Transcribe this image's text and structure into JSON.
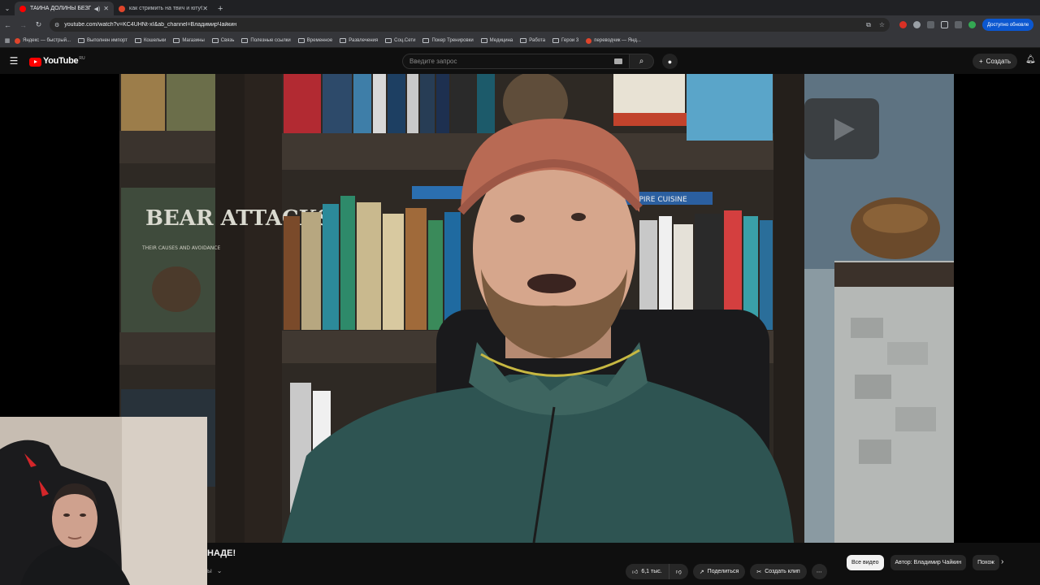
{
  "browser": {
    "tabs": [
      {
        "title": "ТАЙНА ДОЛИНЫ БЕЗГОЛ",
        "favicon_color": "#ff0000",
        "active": true,
        "audio": true
      },
      {
        "title": "как стримить на твич и ютуб",
        "favicon_color": "#e0452b",
        "active": false,
        "audio": false
      }
    ],
    "new_tab_label": "+",
    "url": "youtube.com/watch?v=KC4UHNt-xI&ab_channel=ВладимирЧайкин",
    "update_label": "Доступно обновле",
    "bookmarks": [
      {
        "label": "Яндекс — быстрый..."
      },
      {
        "label": "Выполнен импорт"
      },
      {
        "label": "Кошельки"
      },
      {
        "label": "Магазины"
      },
      {
        "label": "Связь"
      },
      {
        "label": "Полезные ссылки"
      },
      {
        "label": "Временное"
      },
      {
        "label": "Развлечения"
      },
      {
        "label": "Соц.Сети"
      },
      {
        "label": "Покер Тренировки"
      },
      {
        "label": "Медицина"
      },
      {
        "label": "Работа"
      },
      {
        "label": "Герои 3"
      },
      {
        "label": "переводчик — Янд..."
      }
    ]
  },
  "youtube": {
    "logo_text": "YouTube",
    "logo_region": "RU",
    "search_placeholder": "Введите запрос",
    "create_label": "Создать"
  },
  "video": {
    "title_fragment": "НАДЕ!",
    "subscribe_fragment": "ы",
    "likes": "6,1 тыс.",
    "share_label": "Поделиться",
    "clip_label": "Создать клип",
    "book_title": "BEAR ATTACKS",
    "book_subtitle": "THEIR CAUSES AND AVOIDANCE",
    "book_spine_word": "EMPIRE CUISINE"
  },
  "chips": [
    {
      "label": "Все видео",
      "active": true
    },
    {
      "label": "Автор: Владимир Чайкин",
      "active": false
    },
    {
      "label": "Похож",
      "active": false
    }
  ],
  "colors": {
    "youtube_red": "#ff0000",
    "page_bg": "#0f0f0f",
    "chrome_bg": "#35363a",
    "update_blue": "#0b57d0"
  }
}
